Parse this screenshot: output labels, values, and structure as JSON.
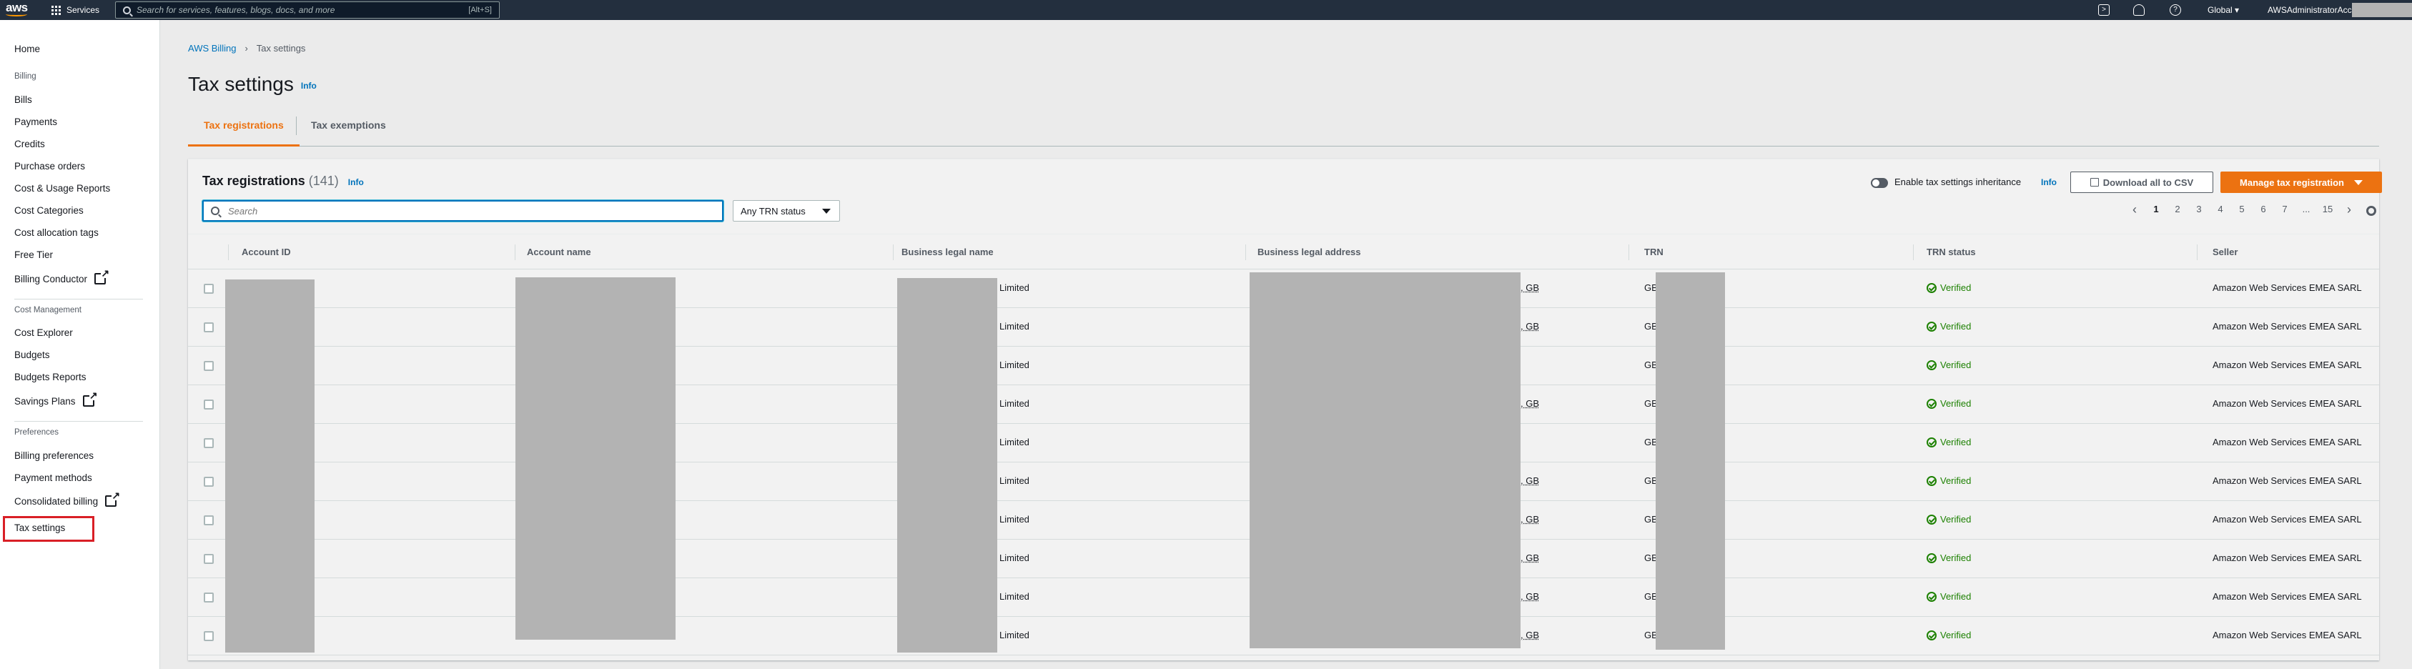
{
  "topbar": {
    "logo": "aws",
    "services_label": "Services",
    "search_placeholder": "Search for services, features, blogs, docs, and more",
    "search_shortcut": "[Alt+S]",
    "region_label": "Global",
    "account_label": "AWSAdministratorAccess/"
  },
  "sidebar": {
    "home": "Home",
    "section_billing": "Billing",
    "billing_items": [
      "Bills",
      "Payments",
      "Credits",
      "Purchase orders",
      "Cost & Usage Reports",
      "Cost Categories",
      "Cost allocation tags",
      "Free Tier",
      "Billing Conductor"
    ],
    "section_cost_management": "Cost Management",
    "cost_items": [
      "Cost Explorer",
      "Budgets",
      "Budgets Reports",
      "Savings Plans"
    ],
    "section_preferences": "Preferences",
    "pref_items": [
      "Billing preferences",
      "Payment methods",
      "Consolidated billing",
      "Tax settings"
    ]
  },
  "breadcrumb": {
    "parent": "AWS Billing",
    "current": "Tax settings"
  },
  "page": {
    "title": "Tax settings",
    "info": "Info"
  },
  "tabs": [
    "Tax registrations",
    "Tax exemptions"
  ],
  "panel": {
    "title": "Tax registrations",
    "count": "(141)",
    "info": "Info",
    "toggle_label": "Enable tax settings inheritance",
    "toggle_info": "Info",
    "download_label": "Download all to CSV",
    "manage_label": "Manage tax registration",
    "search_placeholder": "Search",
    "filter_value": "Any TRN status",
    "pagination": [
      "1",
      "2",
      "3",
      "4",
      "5",
      "6",
      "7",
      "...",
      "15"
    ]
  },
  "table": {
    "columns": [
      "Account ID",
      "Account name",
      "Business legal name",
      "Business legal address",
      "TRN",
      "TRN status",
      "Seller"
    ],
    "rows": [
      {
        "legal": "Limited",
        "addr": ", GB",
        "trn": "GB",
        "status": "Verified",
        "seller": "Amazon Web Services EMEA SARL"
      },
      {
        "legal": "Limited",
        "addr": ", GB",
        "trn": "GB",
        "status": "Verified",
        "seller": "Amazon Web Services EMEA SARL"
      },
      {
        "legal": "Limited",
        "addr": "",
        "trn": "GB",
        "status": "Verified",
        "seller": "Amazon Web Services EMEA SARL"
      },
      {
        "legal": "Limited",
        "addr": ", GB",
        "trn": "GB",
        "status": "Verified",
        "seller": "Amazon Web Services EMEA SARL"
      },
      {
        "legal": "Limited",
        "addr": "",
        "trn": "GB",
        "status": "Verified",
        "seller": "Amazon Web Services EMEA SARL"
      },
      {
        "legal": "Limited",
        "addr": ", GB",
        "trn": "GB",
        "status": "Verified",
        "seller": "Amazon Web Services EMEA SARL"
      },
      {
        "legal": "Limited",
        "addr": ", GB",
        "trn": "GB",
        "status": "Verified",
        "seller": "Amazon Web Services EMEA SARL"
      },
      {
        "legal": "Limited",
        "addr": ", GB",
        "trn": "GB",
        "status": "Verified",
        "seller": "Amazon Web Services EMEA SARL"
      },
      {
        "legal": "Limited",
        "addr": ", GB",
        "trn": "GB",
        "status": "Verified",
        "seller": "Amazon Web Services EMEA SARL"
      },
      {
        "legal": "Limited",
        "addr": ", GB",
        "trn": "GB",
        "status": "Verified",
        "seller": "Amazon Web Services EMEA SARL"
      }
    ]
  },
  "colors": {
    "accent": "#ec7211",
    "link": "#0073bb",
    "success": "#1d8102",
    "header_bg": "#232f3e",
    "highlight_box": "#d91f26"
  }
}
